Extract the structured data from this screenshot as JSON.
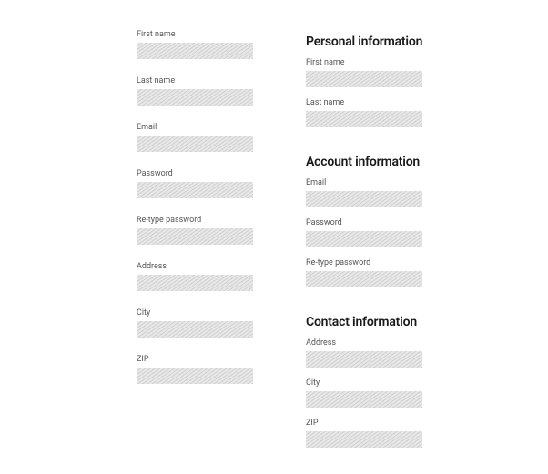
{
  "left": {
    "fields": [
      {
        "label": "First name"
      },
      {
        "label": "Last name"
      },
      {
        "label": "Email"
      },
      {
        "label": "Password"
      },
      {
        "label": "Re-type password"
      },
      {
        "label": "Address"
      },
      {
        "label": "City"
      },
      {
        "label": "ZIP"
      }
    ]
  },
  "right": {
    "sections": [
      {
        "heading": "Personal information",
        "fields": [
          {
            "label": "First name"
          },
          {
            "label": "Last name"
          }
        ]
      },
      {
        "heading": "Account information",
        "fields": [
          {
            "label": "Email"
          },
          {
            "label": "Password"
          },
          {
            "label": "Re-type password"
          }
        ]
      },
      {
        "heading": "Contact information",
        "fields": [
          {
            "label": "Address"
          },
          {
            "label": "City"
          },
          {
            "label": "ZIP"
          }
        ]
      }
    ]
  }
}
